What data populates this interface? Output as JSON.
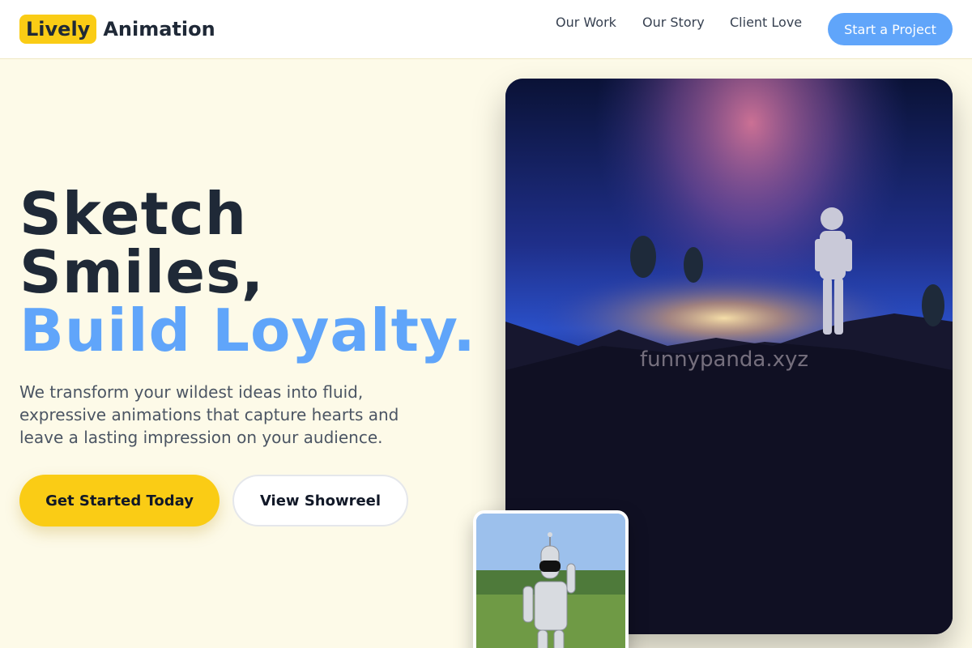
{
  "header": {
    "logo_badge": "Lively",
    "logo_text": "Animation",
    "nav": [
      "Our Work",
      "Our Story",
      "Client Love"
    ],
    "cta": "Start a Project"
  },
  "hero": {
    "headline_line1": "Sketch",
    "headline_line2": "Smiles,",
    "headline_accent": "Build Loyalty.",
    "lead": "We transform your wildest ideas into fluid, expressive animations that capture hearts and leave a lasting impression on your audience.",
    "primary_button": "Get Started Today",
    "secondary_button": "View Showreel"
  },
  "images": {
    "main_watermark": "funnypanda.xyz"
  },
  "colors": {
    "accent_yellow": "#facc15",
    "accent_blue": "#60a5fa",
    "page_background": "#fdfae8",
    "text_dark": "#1f2937"
  }
}
